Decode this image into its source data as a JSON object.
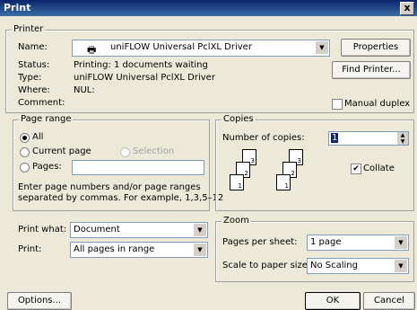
{
  "window": {
    "title": "Print",
    "close_glyph": "x"
  },
  "printer": {
    "legend": "Printer",
    "name_label": "Name:",
    "name_value": "uniFLOW Universal PclXL Driver",
    "properties_label": "Properties",
    "find_printer_label": "Find Printer...",
    "status_label": "Status:",
    "status_value": "Printing: 1 documents waiting",
    "type_label": "Type:",
    "type_value": "uniFLOW Universal PclXL Driver",
    "where_label": "Where:",
    "where_value": "NUL:",
    "comment_label": "Comment:",
    "manual_duplex_label": "Manual duplex",
    "manual_duplex_checked": false
  },
  "page_range": {
    "legend": "Page range",
    "all_label": "All",
    "current_page_label": "Current page",
    "selection_label": "Selection",
    "pages_label": "Pages:",
    "pages_value": "",
    "selected": "all",
    "hint_line1": "Enter page numbers and/or page ranges",
    "hint_line2": "separated by commas.  For example, 1,3,5–12"
  },
  "copies": {
    "legend": "Copies",
    "number_label": "Number of copies:",
    "number_value": "1",
    "collate_label": "Collate",
    "collate_checked": true,
    "sheet_numbers": [
      "1",
      "2",
      "3"
    ]
  },
  "print_options": {
    "print_what_label": "Print what:",
    "print_what_value": "Document",
    "print_label": "Print:",
    "print_value": "All pages in range"
  },
  "zoom": {
    "legend": "Zoom",
    "pages_per_sheet_label": "Pages per sheet:",
    "pages_per_sheet_value": "1 page",
    "scale_label": "Scale to paper size:",
    "scale_value": "No Scaling"
  },
  "footer": {
    "options_label": "Options...",
    "ok_label": "OK",
    "cancel_label": "Cancel"
  }
}
